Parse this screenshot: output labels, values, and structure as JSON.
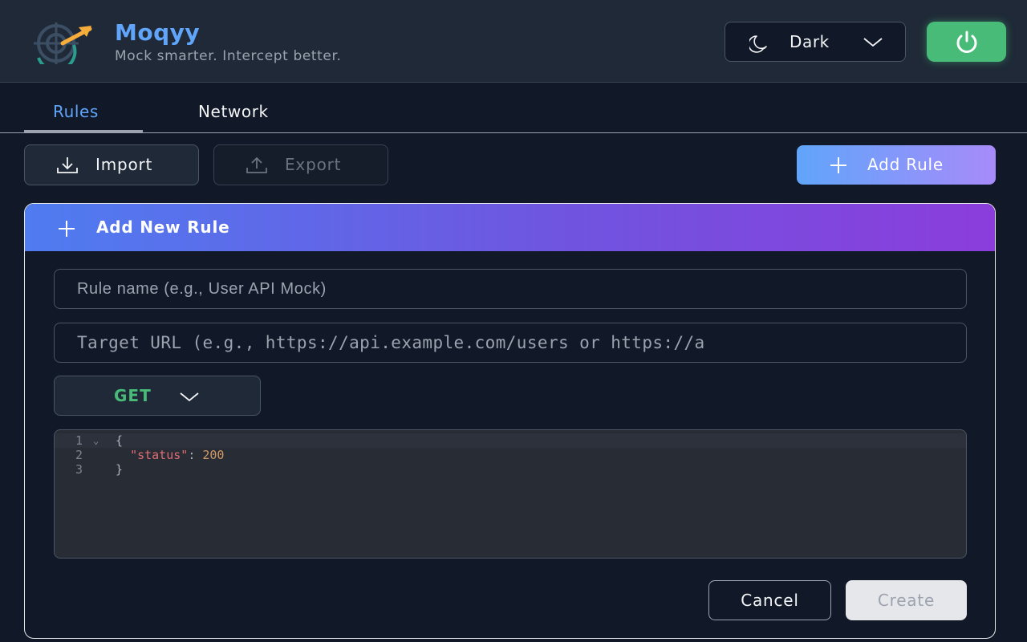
{
  "header": {
    "title": "Moqyy",
    "tagline": "Mock smarter. Intercept better.",
    "logo_icon": "target-arrow-icon",
    "theme_label": "Dark",
    "theme_icon": "moon-icon",
    "power_icon": "power-icon",
    "power_color": "#48bb78"
  },
  "tabs": [
    {
      "label": "Rules",
      "active": true
    },
    {
      "label": "Network",
      "active": false
    }
  ],
  "toolbar": {
    "import_label": "Import",
    "export_label": "Export",
    "add_rule_label": "Add Rule"
  },
  "form": {
    "title": "Add New Rule",
    "name_placeholder": "Rule name (e.g., User API Mock)",
    "url_placeholder": "Target URL (e.g., https://api.example.com/users or https://a",
    "method": "GET",
    "method_color": "#48bb78",
    "editor": {
      "lines": [
        {
          "num": "1",
          "code": "{"
        },
        {
          "num": "2",
          "key": "\"status\"",
          "sep": ": ",
          "value": "200"
        },
        {
          "num": "3",
          "code": "}"
        }
      ]
    },
    "cancel_label": "Cancel",
    "create_label": "Create"
  },
  "colors": {
    "accent": "#60a5fa",
    "gradient_start": "#4f7cf0",
    "gradient_end": "#8b3ddb",
    "background": "#111827"
  }
}
